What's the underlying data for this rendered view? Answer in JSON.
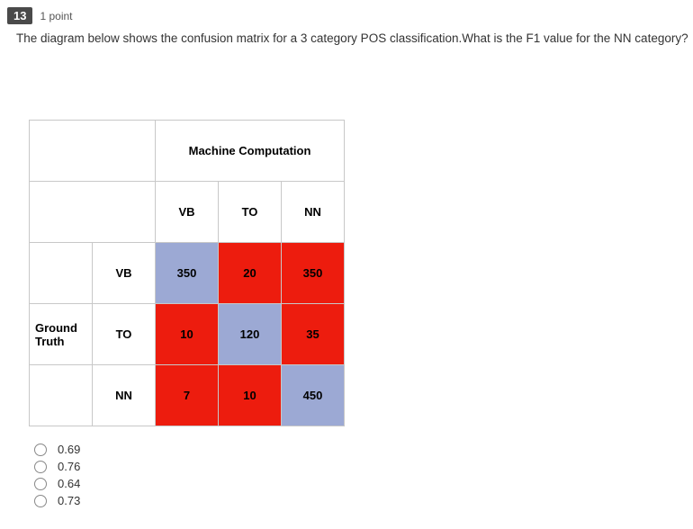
{
  "question": {
    "number": "13",
    "points": "1 point",
    "text": "The diagram below shows the confusion matrix for a 3 category POS classification.What is the F1 value for the NN category?"
  },
  "matrix": {
    "machine_label": "Machine Computation",
    "ground_label": "Ground Truth",
    "cols": {
      "c1": "VB",
      "c2": "TO",
      "c3": "NN"
    },
    "rows": {
      "r1": "VB",
      "r2": "TO",
      "r3": "NN"
    },
    "cells": {
      "r1c1": "350",
      "r1c2": "20",
      "r1c3": "350",
      "r2c1": "10",
      "r2c2": "120",
      "r2c3": "35",
      "r3c1": "7",
      "r3c2": "10",
      "r3c3": "450"
    }
  },
  "options": {
    "a": "0.69",
    "b": "0.76",
    "c": "0.64",
    "d": "0.73"
  },
  "chart_data": {
    "type": "table",
    "title": "Confusion Matrix (Ground Truth rows vs Machine Computation cols)",
    "categories": [
      "VB",
      "TO",
      "NN"
    ],
    "series": [
      {
        "name": "VB",
        "values": [
          350,
          20,
          350
        ]
      },
      {
        "name": "TO",
        "values": [
          10,
          120,
          35
        ]
      },
      {
        "name": "NN",
        "values": [
          7,
          10,
          450
        ]
      }
    ]
  }
}
